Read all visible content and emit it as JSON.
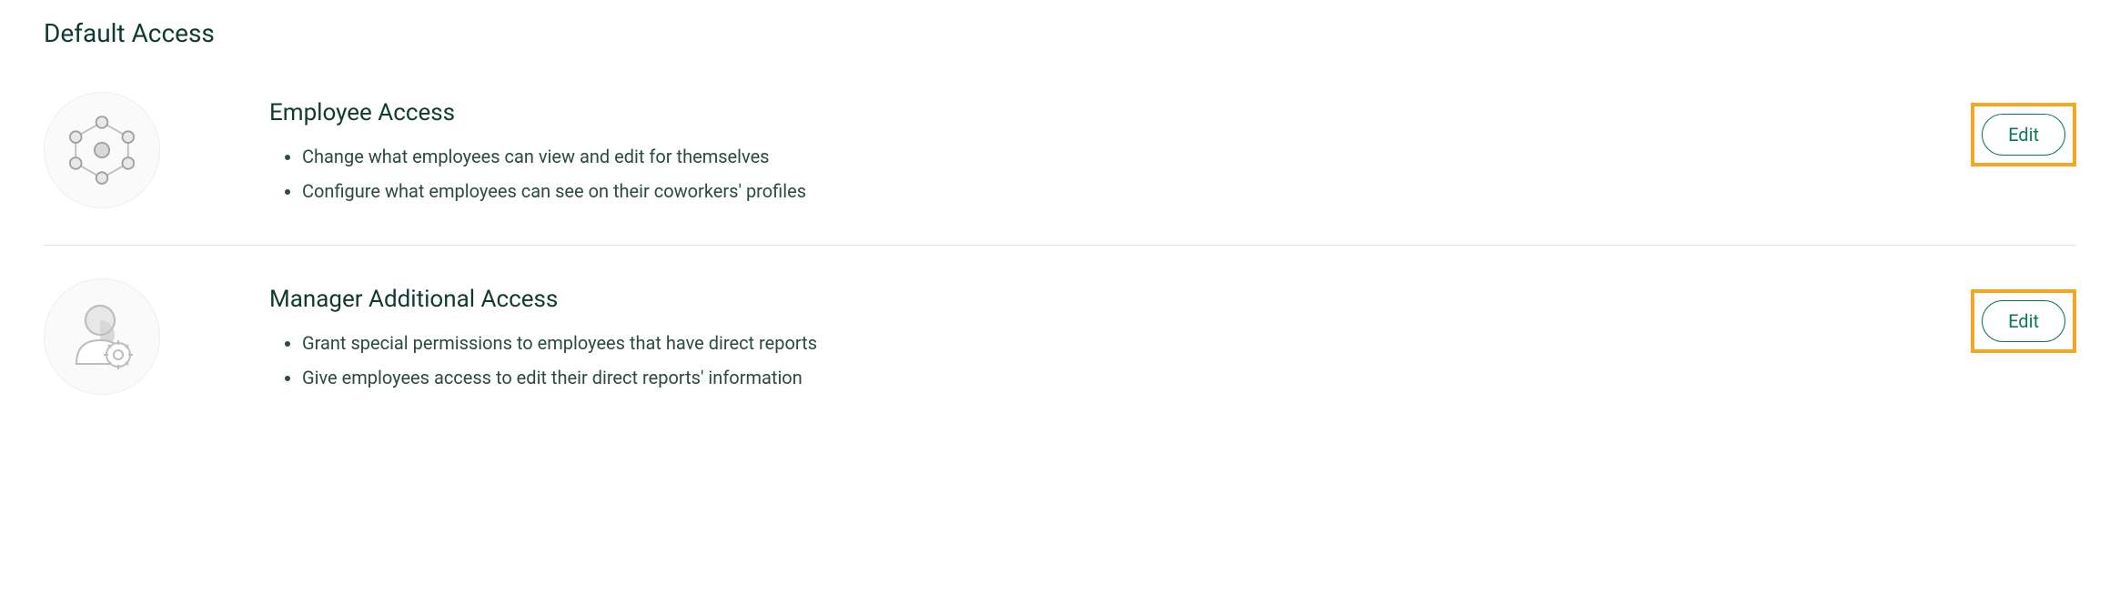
{
  "section_title": "Default Access",
  "rows": [
    {
      "title": "Employee Access",
      "bullets": [
        "Change what employees can view and edit for themselves",
        "Configure what employees can see on their coworkers' profiles"
      ],
      "edit_label": "Edit"
    },
    {
      "title": "Manager Additional Access",
      "bullets": [
        "Grant special permissions to employees that have direct reports",
        "Give employees access to edit their direct reports' information"
      ],
      "edit_label": "Edit"
    }
  ]
}
